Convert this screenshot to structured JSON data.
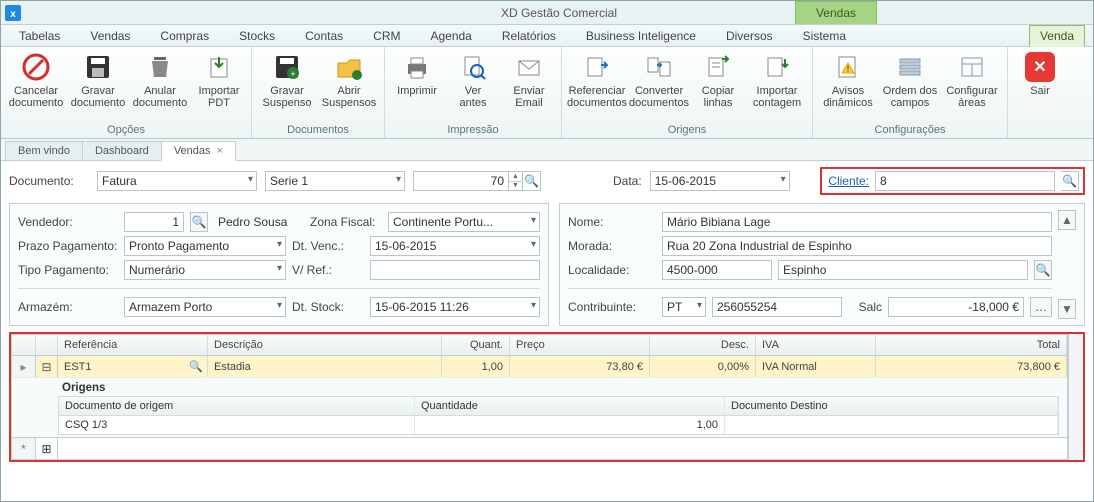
{
  "app": {
    "title": "XD Gestão Comercial",
    "context_tab": "Vendas"
  },
  "menubar": [
    "Tabelas",
    "Vendas",
    "Compras",
    "Stocks",
    "Contas",
    "CRM",
    "Agenda",
    "Relatórios",
    "Business Inteligence",
    "Diversos",
    "Sistema",
    "Venda"
  ],
  "ribbon": {
    "groups": [
      {
        "label": "Opções",
        "buttons": [
          "Cancelar\ndocumento",
          "Gravar\ndocumento",
          "Anular\ndocumento",
          "Importar\nPDT"
        ]
      },
      {
        "label": "Documentos",
        "buttons": [
          "Gravar\nSuspenso",
          "Abrir\nSuspensos"
        ]
      },
      {
        "label": "Impressão",
        "buttons": [
          "Imprimir",
          "Ver\nantes",
          "Enviar\nEmail"
        ]
      },
      {
        "label": "Origens",
        "buttons": [
          "Referenciar\ndocumentos",
          "Converter\ndocumentos",
          "Copiar\nlinhas",
          "Importar\ncontagem"
        ]
      },
      {
        "label": "Configurações",
        "buttons": [
          "Avisos\ndinâmicos",
          "Ordem dos\ncampos",
          "Configurar\náreas"
        ]
      }
    ],
    "exit_label": "Sair"
  },
  "tabs": [
    "Bem vindo",
    "Dashboard",
    "Vendas"
  ],
  "header": {
    "doc_label": "Documento:",
    "doc_type": "Fatura",
    "serie": "Serie 1",
    "number": "70",
    "date_label": "Data:",
    "date": "15-06-2015",
    "client_label": "Cliente:",
    "client": "8"
  },
  "left_panel": {
    "vendedor_label": "Vendedor:",
    "vendedor_num": "1",
    "vendedor_name": "Pedro Sousa",
    "zona_label": "Zona Fiscal:",
    "zona": "Continente Portu...",
    "prazo_label": "Prazo Pagamento:",
    "prazo": "Pronto Pagamento",
    "dtvenc_label": "Dt. Venc.:",
    "dtvenc": "15-06-2015",
    "tipo_label": "Tipo Pagamento:",
    "tipo": "Numerário",
    "vref_label": "V/ Ref.:",
    "vref": "",
    "armazem_label": "Armazém:",
    "armazem": "Armazem Porto",
    "dtstock_label": "Dt. Stock:",
    "dtstock": "15-06-2015 11:26"
  },
  "right_panel": {
    "nome_label": "Nome:",
    "nome": "Mário Bibiana Lage",
    "morada_label": "Morada:",
    "morada": "Rua 20 Zona Industrial de Espinho",
    "localidade_label": "Localidade:",
    "cp": "4500-000",
    "cidade": "Espinho",
    "contribuinte_label": "Contribuinte:",
    "pais": "PT",
    "nif": "256055254",
    "saldo_label": "Salc",
    "saldo": "-18,000 €"
  },
  "grid": {
    "columns": [
      "Referência",
      "Descrição",
      "Quant.",
      "Preço",
      "Desc.",
      "IVA",
      "Total"
    ],
    "row": {
      "ref": "EST1",
      "desc": "Estadia",
      "qty": "1,00",
      "price": "73,80 €",
      "disc": "0,00%",
      "iva": "IVA Normal",
      "total": "73,800 €"
    },
    "sub": {
      "title": "Origens",
      "columns": [
        "Documento de origem",
        "Quantidade",
        "Documento Destino"
      ],
      "row": {
        "doc": "CSQ 1/3",
        "qty": "1,00",
        "dest": ""
      }
    }
  }
}
